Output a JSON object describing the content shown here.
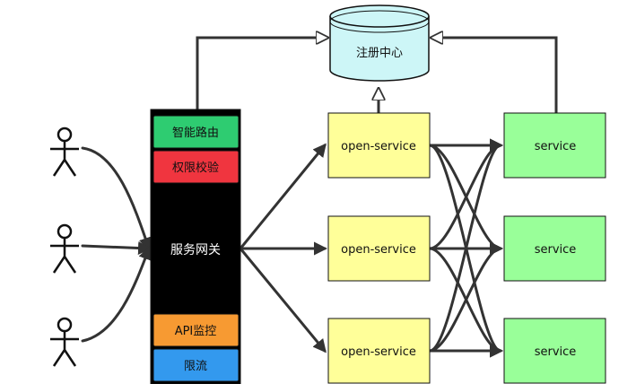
{
  "registry": {
    "label": "注册中心",
    "color": "#cdf6f7"
  },
  "gateway": {
    "label": "服务网关",
    "color": "#000000",
    "modules_top": [
      {
        "label": "智能路由",
        "color": "#2ecc71"
      },
      {
        "label": "权限校验",
        "color": "#f0353f"
      }
    ],
    "modules_bottom": [
      {
        "label": "API监控",
        "color": "#f79a32"
      },
      {
        "label": "限流",
        "color": "#3399ee"
      }
    ]
  },
  "open_services": [
    {
      "label": "open-service"
    },
    {
      "label": "open-service"
    },
    {
      "label": "open-service"
    }
  ],
  "services": [
    {
      "label": "service"
    },
    {
      "label": "service"
    },
    {
      "label": "service"
    }
  ],
  "colors": {
    "open_service_fill": "#ffff99",
    "service_fill": "#99ff99",
    "line": "#333333"
  }
}
